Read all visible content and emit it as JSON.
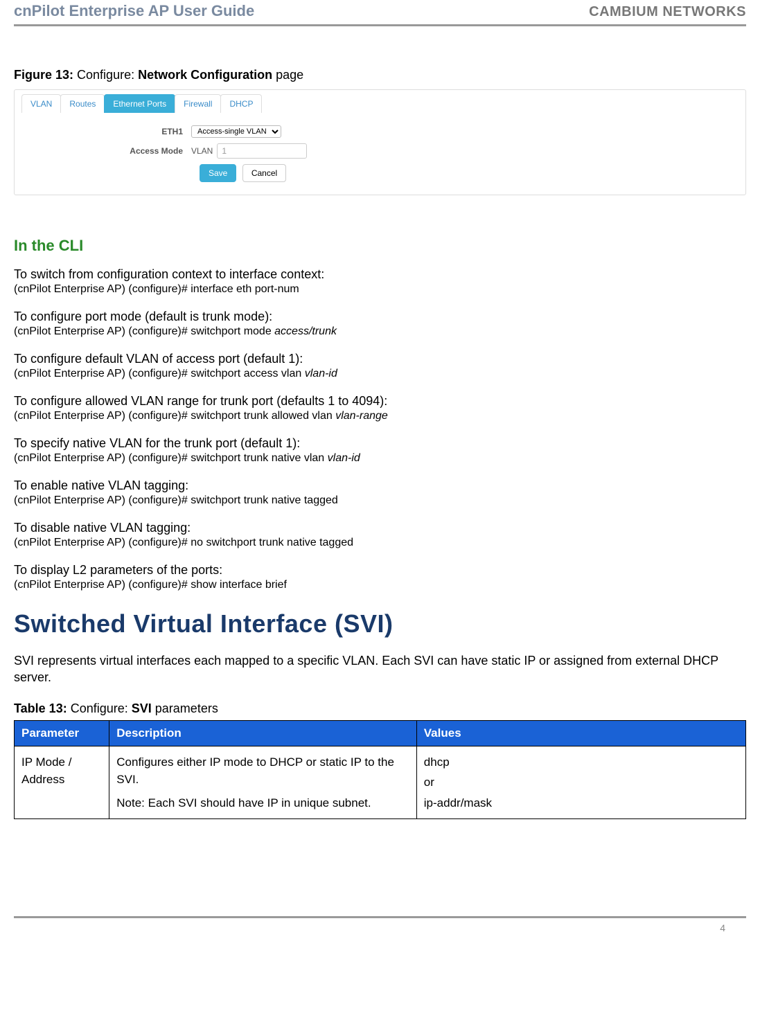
{
  "header": {
    "left": "cnPilot Enterprise AP User Guide",
    "right": "CAMBIUM NETWORKS"
  },
  "figure": {
    "prefix": "Figure 13:",
    "mid": " Configure: ",
    "name": "Network Configuration",
    "suffix": " page"
  },
  "screenshot": {
    "tabs": [
      "VLAN",
      "Routes",
      "Ethernet Ports",
      "Firewall",
      "DHCP"
    ],
    "activeIndex": 2,
    "eth1Label": "ETH1",
    "eth1Select": "Access-single VLAN",
    "accessModeLabel": "Access Mode",
    "vlanInline": "VLAN",
    "vlanValue": "1",
    "save": "Save",
    "cancel": "Cancel"
  },
  "cliHeading": "In the CLI",
  "cli": [
    {
      "desc": "To switch from configuration context to interface context:",
      "cmdPrefix": "(cnPilot Enterprise AP) (configure)# interface eth port-num",
      "italic": ""
    },
    {
      "desc": "To configure port mode (default is trunk mode):",
      "cmdPrefix": "(cnPilot Enterprise AP) (configure)# switchport mode ",
      "italic": "access/trunk"
    },
    {
      "desc": "To configure default VLAN of access port (default 1):",
      "cmdPrefix": "(cnPilot Enterprise AP) (configure)# switchport access vlan ",
      "italic": "vlan-id"
    },
    {
      "desc": "To configure allowed VLAN range for trunk port (defaults 1 to 4094):",
      "cmdPrefix": "(cnPilot Enterprise AP) (configure)# switchport trunk allowed vlan ",
      "italic": "vlan-range"
    },
    {
      "desc": "To specify native VLAN for the trunk port (default 1):",
      "cmdPrefix": "(cnPilot Enterprise AP) (configure)# switchport trunk native vlan ",
      "italic": "vlan-id"
    },
    {
      "desc": "To enable native VLAN tagging:",
      "cmdPrefix": "(cnPilot Enterprise AP) (configure)# switchport trunk native tagged",
      "italic": ""
    },
    {
      "desc": "To disable native VLAN tagging:",
      "cmdPrefix": "(cnPilot Enterprise AP) (configure)# no switchport trunk native tagged",
      "italic": ""
    },
    {
      "desc": "To display L2 parameters of the ports:",
      "cmdPrefix": "(cnPilot Enterprise AP) (configure)# show interface  brief",
      "italic": ""
    }
  ],
  "sviHeading": "Switched Virtual Interface (SVI)",
  "sviBody": "SVI represents virtual interfaces each mapped to a specific VLAN. Each SVI can have static IP or assigned from external DHCP server.",
  "tableCaption": {
    "prefix": "Table 13:",
    "mid": " Configure: ",
    "name": "SVI",
    "suffix": " parameters"
  },
  "table": {
    "headers": [
      "Parameter",
      "Description",
      "Values"
    ],
    "rows": [
      {
        "param": "IP Mode / Address",
        "desc1": "Configures either IP mode to DHCP or static IP to the SVI.",
        "desc2": "Note: Each SVI should have IP in unique subnet.",
        "val1": "dhcp",
        "val2": "or",
        "val3": "ip-addr/mask"
      }
    ]
  },
  "footer": {
    "page": "4"
  }
}
